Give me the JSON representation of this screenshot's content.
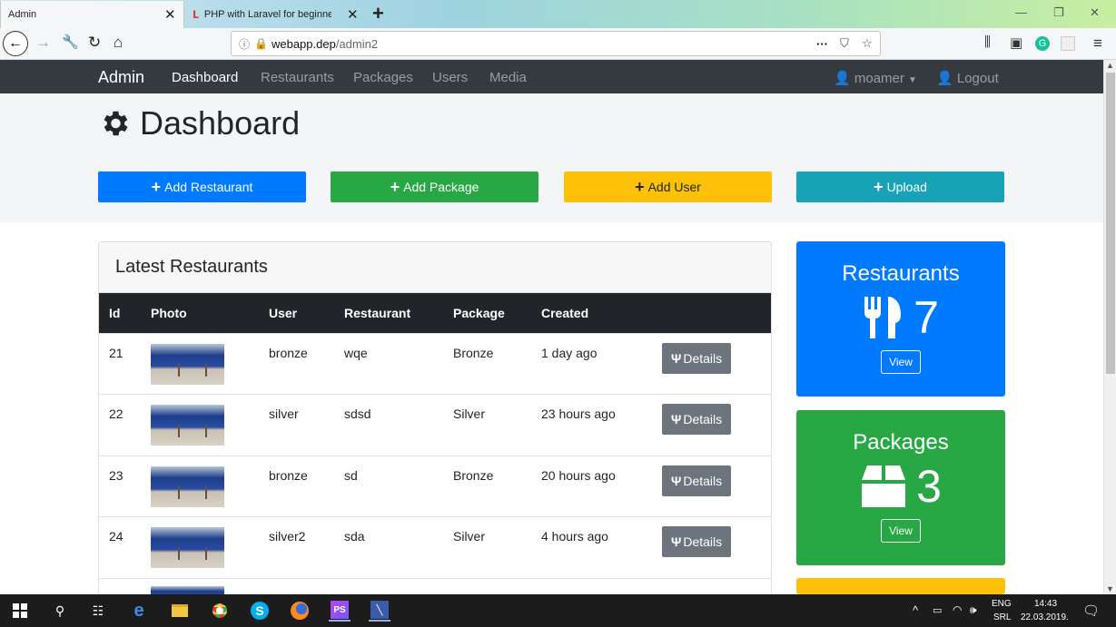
{
  "browser": {
    "tabs": [
      {
        "label": "Admin",
        "active": true
      },
      {
        "label": "PHP with Laravel for beginners",
        "active": false
      }
    ],
    "url_host": "webapp.dep",
    "url_path": "/admin2"
  },
  "appnav": {
    "brand": "Admin",
    "links": [
      "Dashboard",
      "Restaurants",
      "Packages",
      "Users",
      "Media"
    ],
    "user": "moamer",
    "logout": "Logout"
  },
  "page": {
    "title": "Dashboard",
    "buttons": [
      "Add Restaurant",
      "Add Package",
      "Add User",
      "Upload"
    ]
  },
  "latest": {
    "header": "Latest Restaurants",
    "columns": [
      "Id",
      "Photo",
      "User",
      "Restaurant",
      "Package",
      "Created"
    ],
    "details_label": "Details",
    "rows": [
      {
        "id": "21",
        "user": "bronze",
        "restaurant": "wqe",
        "package": "Bronze",
        "created": "1 day ago"
      },
      {
        "id": "22",
        "user": "silver",
        "restaurant": "sdsd",
        "package": "Silver",
        "created": "23 hours ago"
      },
      {
        "id": "23",
        "user": "bronze",
        "restaurant": "sd",
        "package": "Bronze",
        "created": "20 hours ago"
      },
      {
        "id": "24",
        "user": "silver2",
        "restaurant": "sda",
        "package": "Silver",
        "created": "4 hours ago"
      }
    ]
  },
  "stats": [
    {
      "title": "Restaurants",
      "count": "7",
      "view": "View",
      "color": "#007bff"
    },
    {
      "title": "Packages",
      "count": "3",
      "view": "View",
      "color": "#28a745"
    }
  ],
  "colors": {
    "primary": "#007bff",
    "success": "#28a745",
    "warning": "#ffc107",
    "info": "#17a2b8",
    "secondary": "#6c757d",
    "dark": "#343a40"
  },
  "taskbar": {
    "lang": "ENG",
    "layout": "SRL",
    "time": "14:43",
    "date": "22.03.2019."
  }
}
